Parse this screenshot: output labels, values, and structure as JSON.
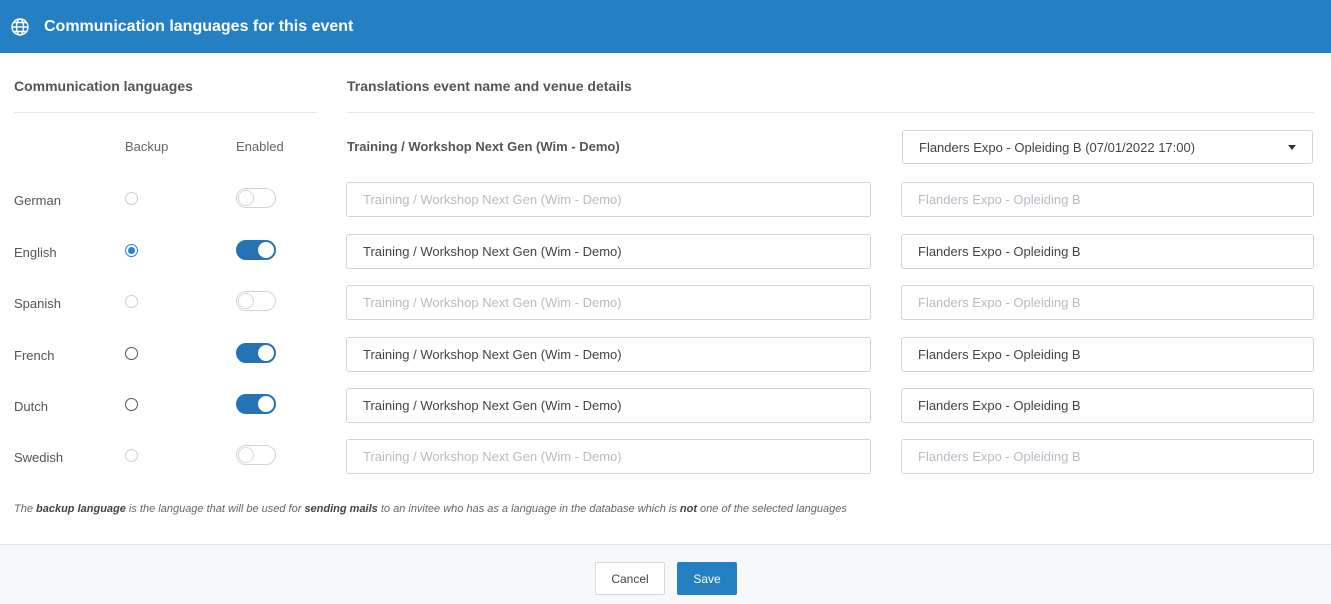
{
  "header": {
    "title": "Communication languages for this event",
    "icon": "globe-icon",
    "color": "#2580c3"
  },
  "left": {
    "title": "Communication languages",
    "col_backup": "Backup",
    "col_enabled": "Enabled"
  },
  "right": {
    "title": "Translations event name and venue details",
    "event_name": "Training / Workshop Next Gen (Wim - Demo)",
    "venue_select": "Flanders Expo - Opleiding B (07/01/2022 17:00)"
  },
  "languages": [
    {
      "label": "German",
      "backup": false,
      "backup_disabled": true,
      "enabled": false,
      "name_value": "Training / Workshop Next Gen (Wim - Demo)",
      "venue_value": "Flanders Expo - Opleiding B"
    },
    {
      "label": "English",
      "backup": true,
      "backup_disabled": false,
      "enabled": true,
      "name_value": "Training / Workshop Next Gen (Wim - Demo)",
      "venue_value": "Flanders Expo - Opleiding B"
    },
    {
      "label": "Spanish",
      "backup": false,
      "backup_disabled": true,
      "enabled": false,
      "name_value": "Training / Workshop Next Gen (Wim - Demo)",
      "venue_value": "Flanders Expo - Opleiding B"
    },
    {
      "label": "French",
      "backup": false,
      "backup_disabled": false,
      "enabled": true,
      "name_value": "Training / Workshop Next Gen (Wim - Demo)",
      "venue_value": "Flanders Expo - Opleiding B"
    },
    {
      "label": "Dutch",
      "backup": false,
      "backup_disabled": false,
      "enabled": true,
      "name_value": "Training / Workshop Next Gen (Wim - Demo)",
      "venue_value": "Flanders Expo - Opleiding B"
    },
    {
      "label": "Swedish",
      "backup": false,
      "backup_disabled": true,
      "enabled": false,
      "name_value": "Training / Workshop Next Gen (Wim - Demo)",
      "venue_value": "Flanders Expo - Opleiding B"
    }
  ],
  "note": {
    "p1": "The ",
    "b1": "backup language",
    "p2": " is the language that will be used for ",
    "b2": "sending mails",
    "p3": " to an invitee who has as a language in the database which is ",
    "b3": "not",
    "p4": " one of the selected languages"
  },
  "footer": {
    "cancel_label": "Cancel",
    "save_label": "Save"
  }
}
